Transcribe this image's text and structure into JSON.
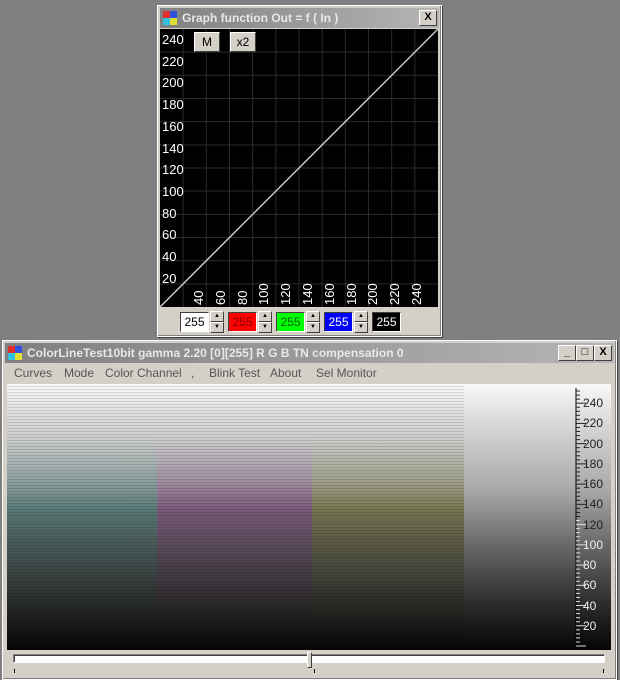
{
  "graph_window": {
    "title": "Graph function Out = f ( In )",
    "close_label": "X",
    "buttons": {
      "m_label": "M",
      "x2_label": "x2"
    },
    "y_ticks": [
      "240",
      "220",
      "200",
      "180",
      "160",
      "140",
      "120",
      "100",
      "80",
      "60",
      "40",
      "20"
    ],
    "x_ticks": [
      "40",
      "60",
      "80",
      "100",
      "120",
      "140",
      "160",
      "180",
      "200",
      "220",
      "240"
    ],
    "curve": {
      "type": "line",
      "from_in": 0,
      "to_in": 255,
      "from_out": 0,
      "to_out": 255
    },
    "controls": [
      {
        "name": "white",
        "value": "255",
        "bg": "#ffffff",
        "fg": "#000000"
      },
      {
        "name": "red",
        "value": "255",
        "bg": "#ff0000",
        "fg": "#800000"
      },
      {
        "name": "green",
        "value": "255",
        "bg": "#00ff00",
        "fg": "#006000"
      },
      {
        "name": "blue",
        "value": "255",
        "bg": "#0000ff",
        "fg": "#ffffff"
      },
      {
        "name": "black",
        "value": "255",
        "bg": "#000000",
        "fg": "#ffffff"
      }
    ]
  },
  "main_window": {
    "title": "ColorLineTest10bit gamma 2.20 [0][255]   R G B  TN compensation 0",
    "window_buttons": {
      "minimize": "_",
      "maximize": "□",
      "close": "X"
    },
    "menu": [
      "Curves",
      "Mode",
      "Color Channel",
      ",",
      "Blink Test",
      "About",
      "Sel Monitor"
    ],
    "strips": [
      {
        "name": "cyan",
        "color": "#7fc6c0"
      },
      {
        "name": "magenta",
        "color": "#c884c8"
      },
      {
        "name": "yellow",
        "color": "#c0c070"
      },
      {
        "name": "gray",
        "color": "none"
      }
    ],
    "ruler_labels": [
      "240",
      "220",
      "200",
      "180",
      "160",
      "140",
      "120",
      "100",
      "80",
      "60",
      "40",
      "20"
    ],
    "slider": {
      "position_fraction": 0.5
    }
  }
}
